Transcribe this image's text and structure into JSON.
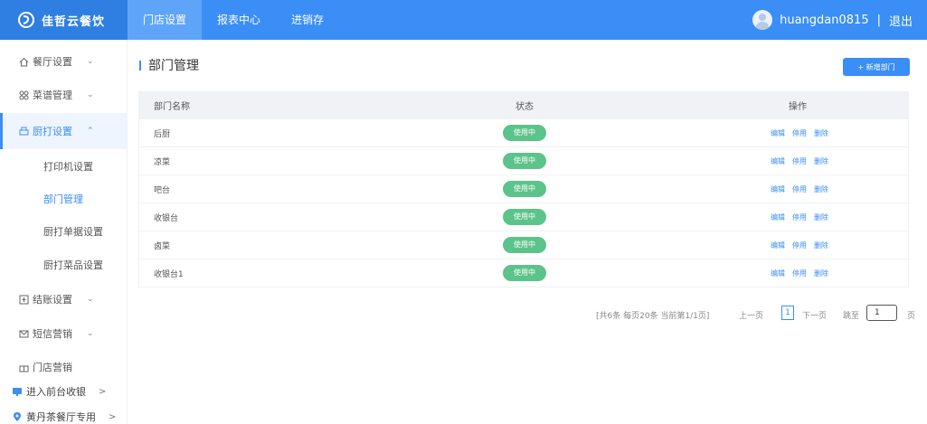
{
  "brand": {
    "name": "佳哲云餐饮"
  },
  "colors": {
    "primary": "#3a8ef6",
    "status_green": "#5cc38a",
    "header_bg": "#3a8ef6"
  },
  "topnav": [
    {
      "label": "门店设置",
      "active": true
    },
    {
      "label": "报表中心",
      "active": false
    },
    {
      "label": "进销存",
      "active": false
    }
  ],
  "user": {
    "name": "huangdan0815",
    "separator": "|",
    "logout": "退出"
  },
  "sidebar": {
    "items": [
      {
        "label": "餐厅设置",
        "icon": "home-icon",
        "chevron": "⌄"
      },
      {
        "label": "菜谱管理",
        "icon": "grid-icon",
        "chevron": "⌄"
      },
      {
        "label": "厨打设置",
        "icon": "printer-icon",
        "chevron": "⌃"
      },
      {
        "label": "结账设置",
        "icon": "checkout-icon",
        "chevron": "⌄"
      },
      {
        "label": "短信营销",
        "icon": "message-icon",
        "chevron": "⌄"
      },
      {
        "label": "门店营销",
        "icon": "gift-icon"
      }
    ],
    "subitems": [
      {
        "label": "打印机设置"
      },
      {
        "label": "部门管理"
      },
      {
        "label": "厨打单据设置"
      },
      {
        "label": "厨打菜品设置"
      }
    ],
    "shortcuts": [
      {
        "label": "进入前台收银",
        "chevron": ">"
      },
      {
        "label": "黄丹茶餐厅专用",
        "chevron": ">"
      }
    ]
  },
  "page": {
    "title": "部门管理",
    "add_button": "+ 新增部门"
  },
  "table": {
    "headers": {
      "name": "部门名称",
      "status": "状态",
      "ops": "操作"
    },
    "rows": [
      {
        "name": "后厨",
        "status": "使用中"
      },
      {
        "name": "凉菜",
        "status": "使用中"
      },
      {
        "name": "吧台",
        "status": "使用中"
      },
      {
        "name": "收银台",
        "status": "使用中"
      },
      {
        "name": "卤菜",
        "status": "使用中"
      },
      {
        "name": "收银台1",
        "status": "使用中"
      }
    ],
    "ops": {
      "edit": "编辑",
      "disable": "停用",
      "delete": "删除"
    }
  },
  "pagination": {
    "summary": "[共6条 每页20条 当前第1/1页]",
    "prev": "上一页",
    "current": "1",
    "next": "下一页",
    "jump_label": "跳至",
    "jump_value": "1",
    "unit": "页"
  }
}
